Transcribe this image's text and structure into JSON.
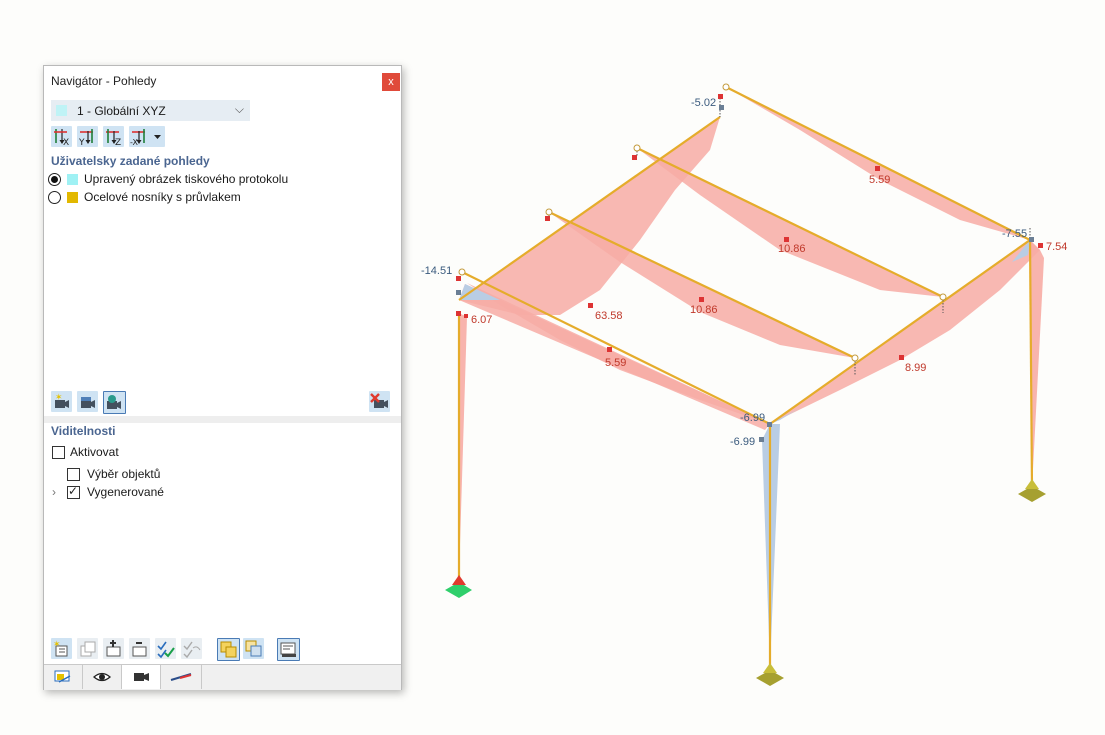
{
  "navigator": {
    "title": "Navigátor - Pohledy",
    "close_label": "x",
    "view_select": {
      "selected": "1 - Globální XYZ",
      "swatch_color": "#bff3f6"
    },
    "view_direction_icons": [
      "view-x-icon",
      "view-y-icon",
      "view-z-icon",
      "view-neg-x-icon"
    ],
    "user_views": {
      "heading": "Uživatelsky zadané pohledy",
      "items": [
        {
          "label": "Upravený obrázek tiskového protokolu",
          "color": "#9ff1f4",
          "selected": true
        },
        {
          "label": "Ocelové nosníky  s průvlakem",
          "color": "#e2b800",
          "selected": false
        }
      ]
    },
    "camera_icons": [
      "new-view-camera-icon",
      "save-view-camera-icon",
      "apply-view-camera-icon",
      "delete-view-camera-icon"
    ],
    "visibility": {
      "heading": "Viditelnosti",
      "activate": {
        "label": "Aktivovat",
        "checked": false
      },
      "items": [
        {
          "label": "Výběr objektů",
          "checked": false
        },
        {
          "label": "Vygenerované",
          "checked": true
        }
      ]
    },
    "bottom_tools": [
      "new-visibility-icon",
      "copy-visibility-icon",
      "add-visibility-icon",
      "remove-visibility-icon",
      "check-all-icon",
      "uncheck-icon",
      "display-objects-icon",
      "display-transparent-icon",
      "settings-icon"
    ],
    "tabs": [
      "data-tab-icon",
      "display-tab-icon",
      "views-tab-icon",
      "results-tab-icon"
    ]
  },
  "model": {
    "labels": [
      "-5.02",
      "5.59",
      "-14.51",
      "6.07",
      "63.58",
      "10.86",
      "10.86",
      "5.59",
      "-7.55",
      "7.54",
      "8.99",
      "-6.99",
      "-6.99"
    ],
    "colors": {
      "member": "#e5ac2b",
      "positive": "#f7aca4",
      "negative": "#b9cde4",
      "pos_text": "#c0392b",
      "neg_text": "#3b5b7e",
      "support": "#a6a030",
      "support_fixed": "#2fcf6b"
    }
  }
}
